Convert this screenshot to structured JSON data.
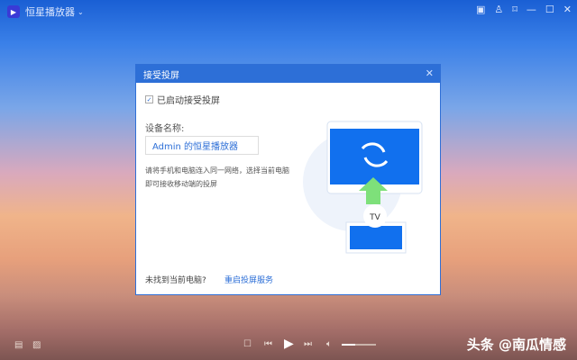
{
  "app": {
    "title": "恒星播放器",
    "logo_icon": "play-logo-icon"
  },
  "window_controls": [
    "skin",
    "shirt",
    "pin",
    "minimize",
    "maximize",
    "close"
  ],
  "dialog": {
    "title": "接受投屏",
    "checkbox_label": "已启动接受投屏",
    "checked": true,
    "device_name_label": "设备名称:",
    "device_name_value": "Admin 的恒星播放器",
    "hint": "请将手机和电脑连入同一网络，选择当前电脑即可接收移动端的投屏",
    "footer_text": "未找到当前电脑?",
    "restart_link": "重启投屏服务",
    "tv_badge": "TV"
  },
  "player": {
    "volume_percent": 40
  },
  "watermark": "头条 @南瓜情感",
  "colors": {
    "accent": "#2d6fd7",
    "arrow": "#7ee07a"
  }
}
